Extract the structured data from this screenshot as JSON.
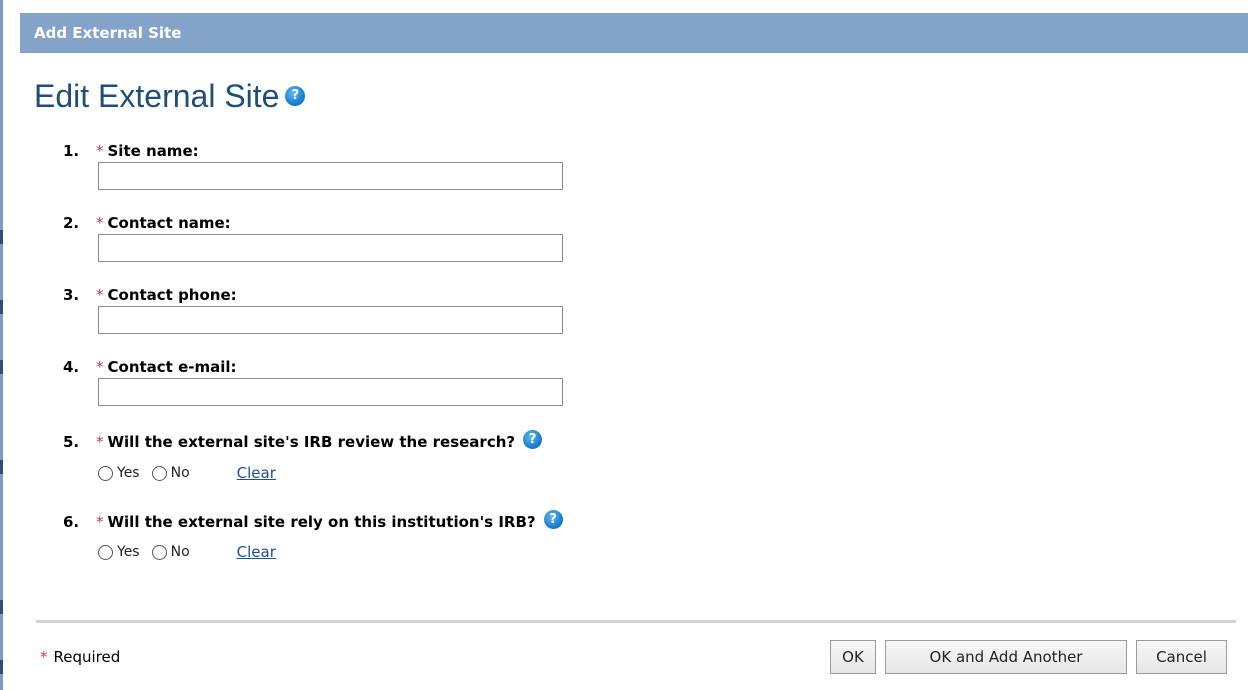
{
  "dialog": {
    "title": "Add External Site"
  },
  "heading": "Edit External Site",
  "help_glyph": "?",
  "required_marker": "*",
  "questions": [
    {
      "num": "1.",
      "label": "Site name:",
      "value": ""
    },
    {
      "num": "2.",
      "label": "Contact name:",
      "value": ""
    },
    {
      "num": "3.",
      "label": "Contact phone:",
      "value": ""
    },
    {
      "num": "4.",
      "label": "Contact e-mail:",
      "value": ""
    },
    {
      "num": "5.",
      "label": "Will the external site's IRB review the research?",
      "options": [
        "Yes",
        "No"
      ],
      "clear": "Clear"
    },
    {
      "num": "6.",
      "label": "Will the external site rely on this institution's IRB?",
      "options": [
        "Yes",
        "No"
      ],
      "clear": "Clear"
    }
  ],
  "footer": {
    "required_note": "Required",
    "ok": "OK",
    "ok_add_another": "OK and Add Another",
    "cancel": "Cancel"
  },
  "colors": {
    "titlebar": "#84a3c8",
    "heading": "#1f4e79",
    "required": "#d23a3a",
    "link": "#1a4f9c"
  }
}
